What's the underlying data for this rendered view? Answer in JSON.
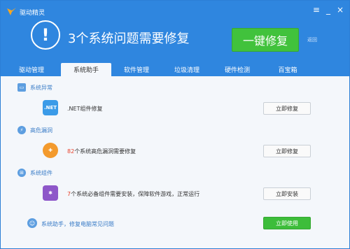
{
  "window": {
    "app_title": "驱动精灵",
    "controls": [
      "≡",
      "_",
      "×"
    ]
  },
  "header": {
    "alert_glyph": "!",
    "headline": "3个系统问题需要修复",
    "fix_all_label": "一键修复",
    "back_label": "返回"
  },
  "tabs": [
    "驱动管理",
    "系统助手",
    "软件管理",
    "垃圾清理",
    "硬件检测",
    "百宝箱"
  ],
  "active_tab": "系统助手",
  "sections": [
    {
      "title": "系统异常",
      "item_icon_text": ".NET",
      "item_pre": "",
      "item_num": "",
      "item_text": ".NET组件修复",
      "button": "立即修复"
    },
    {
      "title": "高危漏洞",
      "item_icon_text": "",
      "item_pre": "",
      "item_num": "82",
      "item_text": "个系统高危漏洞需要修复",
      "button": "立即修复"
    },
    {
      "title": "系统组件",
      "item_icon_text": "",
      "item_pre": "",
      "item_num": "7",
      "item_text": "个系统必备组件需要安装，保障软件游戏，正常运行",
      "button": "立即安装"
    }
  ],
  "bottom": {
    "text": "系统助手，修复电脑常见问题",
    "button": "立即使用"
  },
  "colors": {
    "header_blue": "#2f86df",
    "green": "#41c23c",
    "accent_red": "#e8402a",
    "section_blue": "#3a7cc7"
  }
}
